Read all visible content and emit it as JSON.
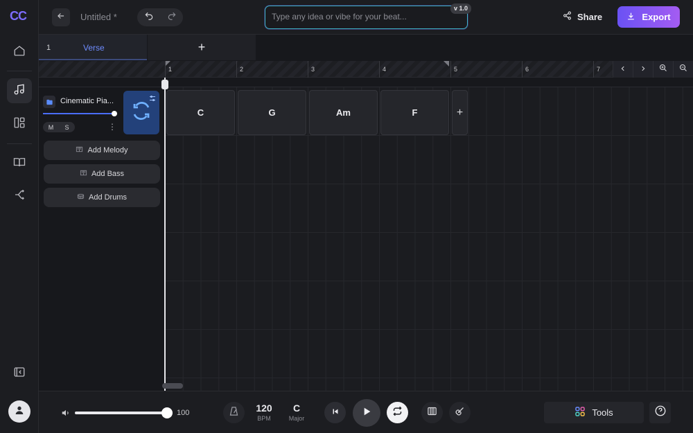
{
  "app": {
    "logo": "CC",
    "title": "Untitled *"
  },
  "prompt": {
    "placeholder": "Type any idea or vibe for your beat...",
    "version": "v 1.0"
  },
  "header": {
    "share_label": "Share",
    "export_label": "Export"
  },
  "sections": [
    {
      "number": "1",
      "name": "Verse"
    }
  ],
  "add_section_label": "+",
  "ruler": {
    "bars": [
      "1",
      "2",
      "3",
      "4",
      "5",
      "6",
      "7"
    ]
  },
  "track": {
    "instrument": "Cinematic Pia...",
    "mute": "M",
    "solo": "S",
    "menu": "⋮"
  },
  "add_tracks": [
    {
      "label": "Add Melody"
    },
    {
      "label": "Add Bass"
    },
    {
      "label": "Add Drums"
    }
  ],
  "chords": [
    "C",
    "G",
    "Am",
    "F"
  ],
  "chord_add": "+",
  "transport": {
    "volume": "100",
    "bpm_value": "120",
    "bpm_label": "BPM",
    "key_value": "C",
    "key_label": "Major",
    "tools_label": "Tools"
  },
  "colors": {
    "accent": "#7d6cff",
    "export_start": "#6a52f4",
    "export_end": "#a45cf2",
    "section_text": "#6f8cff",
    "regen_bg": "#23417a"
  }
}
